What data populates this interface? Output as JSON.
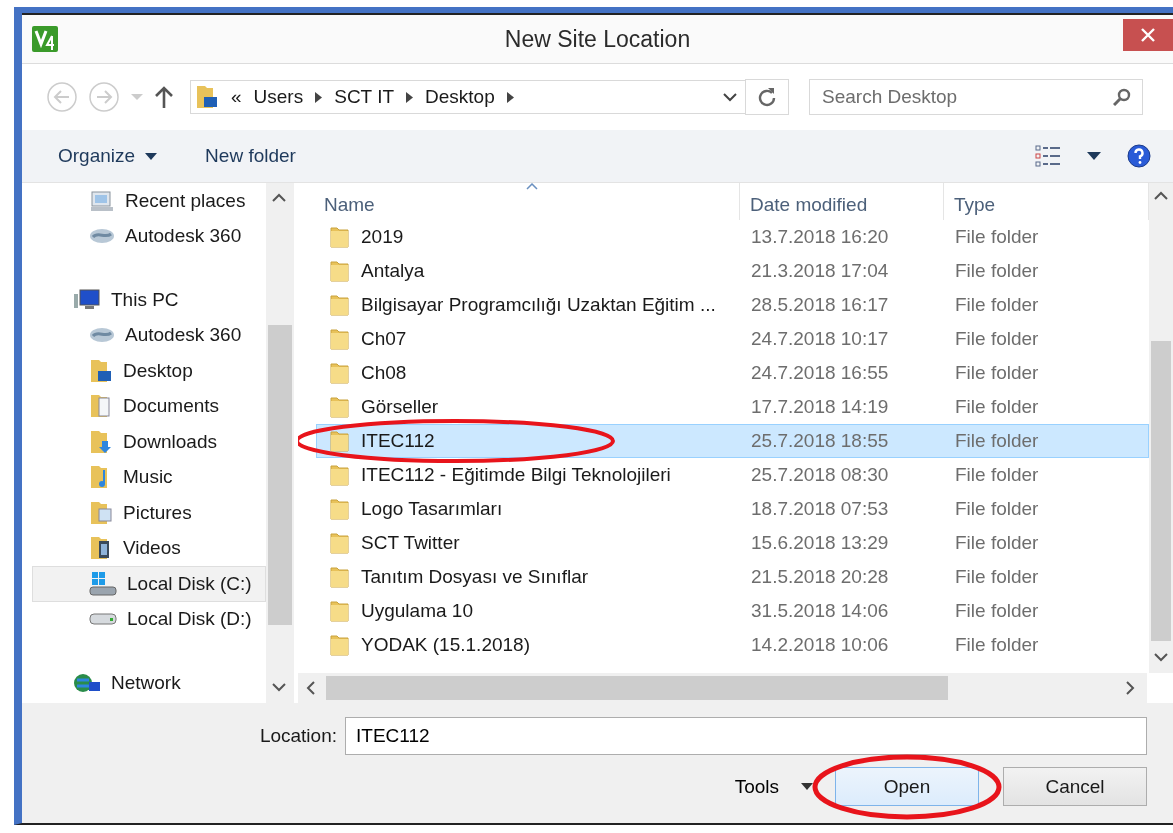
{
  "window": {
    "title": "New Site Location"
  },
  "address": {
    "crumbs": [
      "«",
      "Users",
      "SCT IT",
      "Desktop"
    ]
  },
  "search": {
    "placeholder": "Search Desktop"
  },
  "toolbar": {
    "items": [
      "Organize",
      "New folder"
    ]
  },
  "sidebar": {
    "items": [
      {
        "label": "Recent places",
        "kind": "recent",
        "selected": false
      },
      {
        "label": "Autodesk 360",
        "kind": "cloud",
        "selected": false
      },
      {
        "label": "This PC",
        "kind": "pc",
        "selected": false,
        "children": [
          {
            "label": "Autodesk 360",
            "kind": "cloud",
            "selected": false
          },
          {
            "label": "Desktop",
            "kind": "desktop",
            "selected": false
          },
          {
            "label": "Documents",
            "kind": "documents",
            "selected": false
          },
          {
            "label": "Downloads",
            "kind": "downloads",
            "selected": false
          },
          {
            "label": "Music",
            "kind": "music",
            "selected": false
          },
          {
            "label": "Pictures",
            "kind": "pictures",
            "selected": false
          },
          {
            "label": "Videos",
            "kind": "videos",
            "selected": false
          },
          {
            "label": "Local Disk (C:)",
            "kind": "disk-c",
            "selected": true
          },
          {
            "label": "Local Disk (D:)",
            "kind": "disk",
            "selected": false
          }
        ]
      },
      {
        "label": "Network",
        "kind": "network",
        "selected": false
      }
    ]
  },
  "table": {
    "columns": [
      "Name",
      "Date modified",
      "Type"
    ],
    "rows": [
      {
        "name": "2019",
        "date": "13.7.2018 16:20",
        "type": "File folder",
        "selected": false,
        "circled": false
      },
      {
        "name": "Antalya",
        "date": "21.3.2018 17:04",
        "type": "File folder",
        "selected": false,
        "circled": false
      },
      {
        "name": "Bilgisayar Programcılığı Uzaktan Eğitim ...",
        "date": "28.5.2018 16:17",
        "type": "File folder",
        "selected": false,
        "circled": false
      },
      {
        "name": "Ch07",
        "date": "24.7.2018 10:17",
        "type": "File folder",
        "selected": false,
        "circled": false
      },
      {
        "name": "Ch08",
        "date": "24.7.2018 16:55",
        "type": "File folder",
        "selected": false,
        "circled": false
      },
      {
        "name": "Görseller",
        "date": "17.7.2018 14:19",
        "type": "File folder",
        "selected": false,
        "circled": false
      },
      {
        "name": "ITEC112",
        "date": "25.7.2018 18:55",
        "type": "File folder",
        "selected": true,
        "circled": true
      },
      {
        "name": "ITEC112 - Eğitimde Bilgi Teknolojileri",
        "date": "25.7.2018 08:30",
        "type": "File folder",
        "selected": false,
        "circled": false
      },
      {
        "name": "Logo Tasarımları",
        "date": "18.7.2018 07:53",
        "type": "File folder",
        "selected": false,
        "circled": false
      },
      {
        "name": "SCT Twitter",
        "date": "15.6.2018 13:29",
        "type": "File folder",
        "selected": false,
        "circled": false
      },
      {
        "name": "Tanıtım Dosyası ve Sınıflar",
        "date": "21.5.2018 20:28",
        "type": "File folder",
        "selected": false,
        "circled": false
      },
      {
        "name": "Uygulama 10",
        "date": "31.5.2018 14:06",
        "type": "File folder",
        "selected": false,
        "circled": false
      },
      {
        "name": "YODAK (15.1.2018)",
        "date": "14.2.2018 10:06",
        "type": "File folder",
        "selected": false,
        "circled": false
      }
    ]
  },
  "location": {
    "label": "Location:",
    "value": "ITEC112"
  },
  "footer": {
    "tools": "Tools",
    "buttons": [
      {
        "label": "Open",
        "default": true,
        "circled": true
      },
      {
        "label": "Cancel",
        "default": false,
        "circled": false
      }
    ]
  }
}
